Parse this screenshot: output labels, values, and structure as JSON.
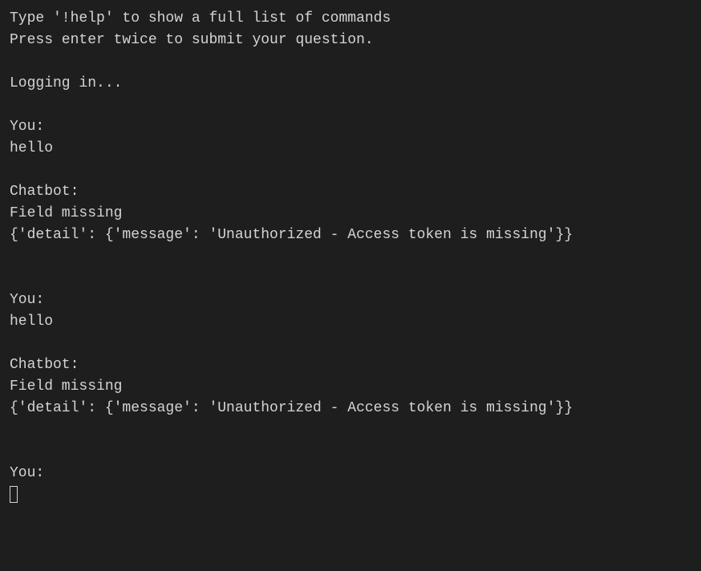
{
  "header": {
    "help_hint": "Type '!help' to show a full list of commands",
    "submit_hint": "Press enter twice to submit your question."
  },
  "status": {
    "logging_in": "Logging in..."
  },
  "conversation": [
    {
      "you_label": "You:",
      "you_text": "hello",
      "bot_label": "Chatbot:",
      "bot_line1": "Field missing",
      "bot_line2": "{'detail': {'message': 'Unauthorized - Access token is missing'}}"
    },
    {
      "you_label": "You:",
      "you_text": "hello",
      "bot_label": "Chatbot:",
      "bot_line1": "Field missing",
      "bot_line2": "{'detail': {'message': 'Unauthorized - Access token is missing'}}"
    }
  ],
  "prompt": {
    "you_label": "You:"
  }
}
